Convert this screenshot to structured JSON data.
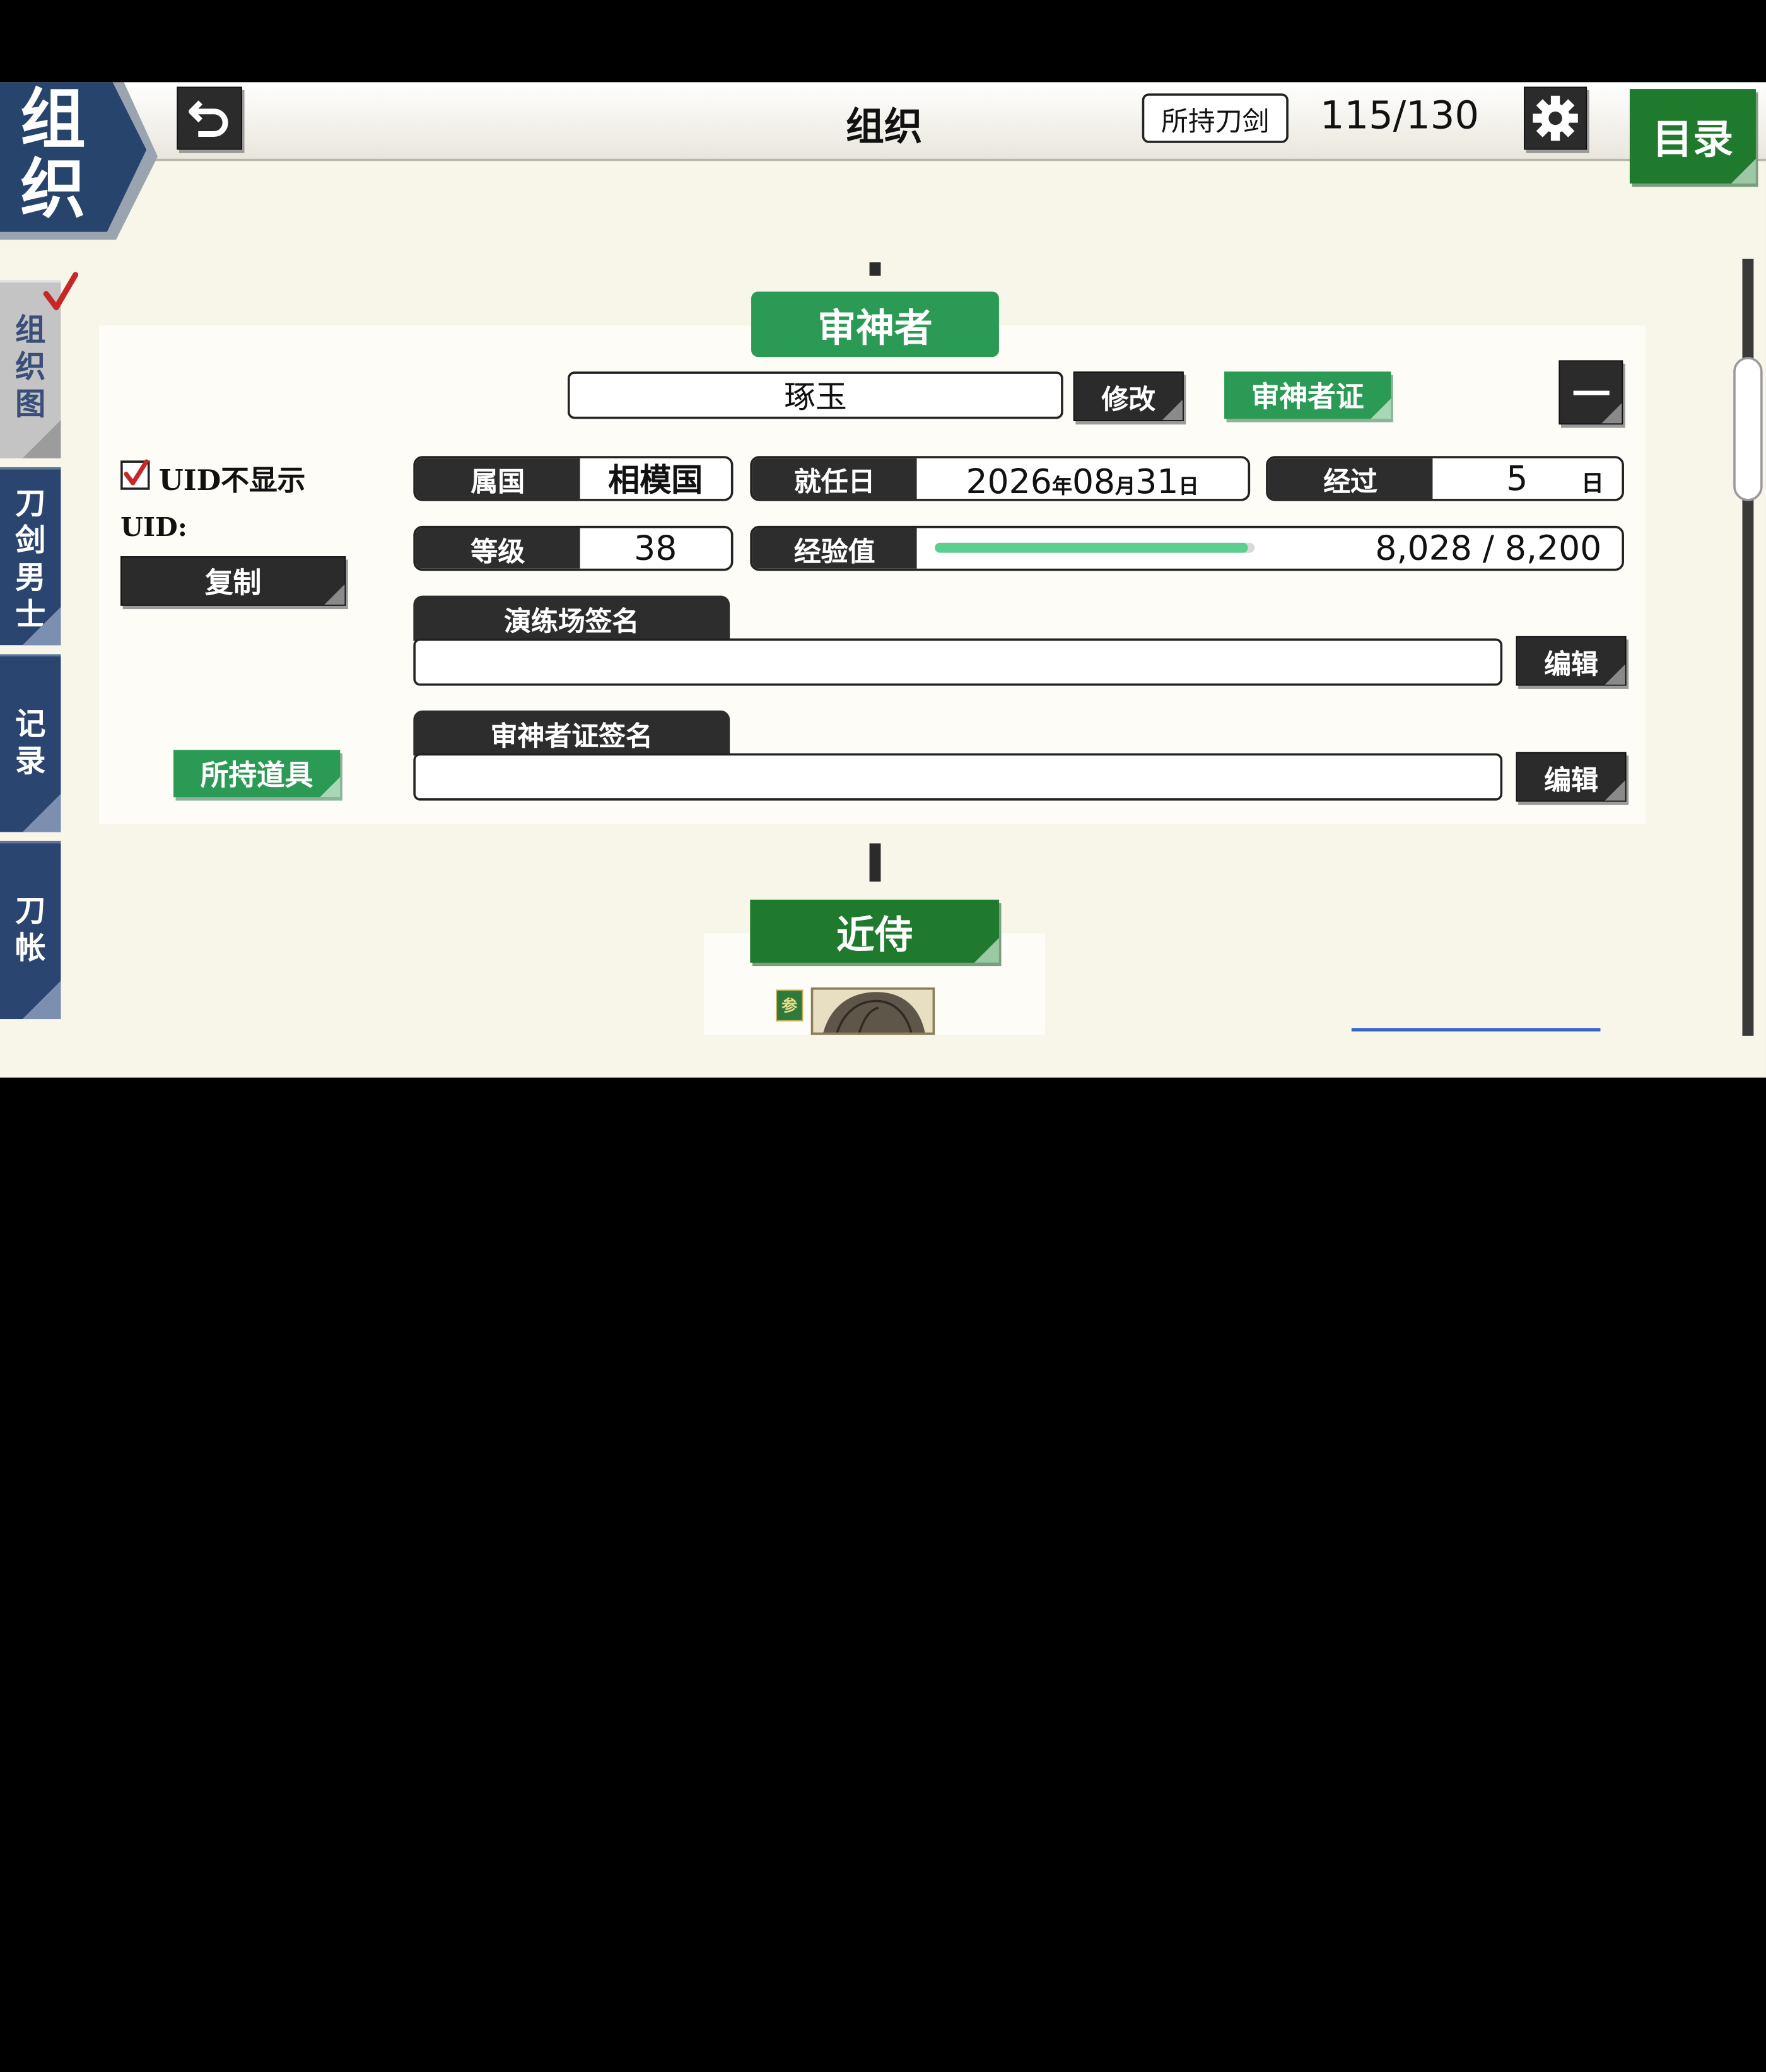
{
  "header": {
    "corner_title": "组织",
    "title": "组织",
    "owned_swords_label": "所持刀剑",
    "owned_swords_count": "115/130",
    "menu_label": "目录"
  },
  "sidebar": {
    "items": [
      {
        "label": "组织图",
        "selected": true
      },
      {
        "label": "刀剑男士",
        "selected": false
      },
      {
        "label": "记录",
        "selected": false
      },
      {
        "label": "刀帐",
        "selected": false
      }
    ]
  },
  "saniwa": {
    "section_title": "审神者",
    "name": "琢玉",
    "edit_name_label": "修改",
    "card_label": "审神者证",
    "collapse_label": "—",
    "uid_hide_label": "UID不显示",
    "uid_hide_checked": true,
    "uid_label": "UID:",
    "copy_label": "复制",
    "items_label": "所持道具",
    "province_key": "属国",
    "province_value": "相模国",
    "appointed_key": "就任日",
    "appointed_year": "2026",
    "appointed_year_unit": "年",
    "appointed_month": "08",
    "appointed_month_unit": "月",
    "appointed_day": "31",
    "appointed_day_unit": "日",
    "elapsed_key": "经过",
    "elapsed_value": "5",
    "elapsed_unit": "日",
    "level_key": "等级",
    "level_value": "38",
    "exp_key": "经验值",
    "exp_value": "8,028 / 8,200",
    "exp_fraction": 0.979,
    "training_sig_label": "演练场签名",
    "training_sig_value": "",
    "card_sig_label": "审神者证签名",
    "card_sig_value": "",
    "edit_label": "编辑"
  },
  "attendant": {
    "section_title": "近侍",
    "badge_label": "参"
  },
  "colors": {
    "green": "#2b9a55",
    "dark_green": "#1f7a2e",
    "navy": "#2a4670",
    "dark": "#2b2b2b",
    "exp_bar": "#5ccf8e",
    "check": "#c62828"
  },
  "icons": [
    "back-arrow-icon",
    "gear-icon",
    "checkmark-icon",
    "minus-icon"
  ]
}
